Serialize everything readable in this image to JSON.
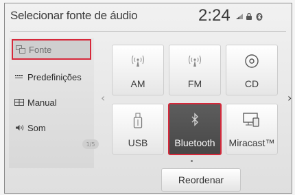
{
  "header": {
    "title": "Selecionar fonte de áudio",
    "time": "2:24"
  },
  "sidebar": {
    "items": [
      {
        "label": "Fonte",
        "icon": "source-icon",
        "selected": true
      },
      {
        "label": "Predefinições",
        "icon": "presets-icon"
      },
      {
        "label": "Manual",
        "icon": "manual-icon"
      },
      {
        "label": "Som",
        "icon": "sound-icon"
      }
    ],
    "scroll_indicator": "1/5"
  },
  "sources": [
    {
      "label": "AM",
      "icon": "radio-antenna-icon"
    },
    {
      "label": "FM",
      "icon": "radio-antenna-icon"
    },
    {
      "label": "CD",
      "icon": "disc-icon"
    },
    {
      "label": "USB",
      "icon": "usb-icon"
    },
    {
      "label": "Bluetooth",
      "icon": "bluetooth-icon",
      "selected": true
    },
    {
      "label": "Miracast™",
      "icon": "miracast-icon"
    }
  ],
  "reorder_label": "Reordenar",
  "colors": {
    "selection_border": "#d6283a",
    "selected_tile_bg": "#4f4f4f"
  }
}
